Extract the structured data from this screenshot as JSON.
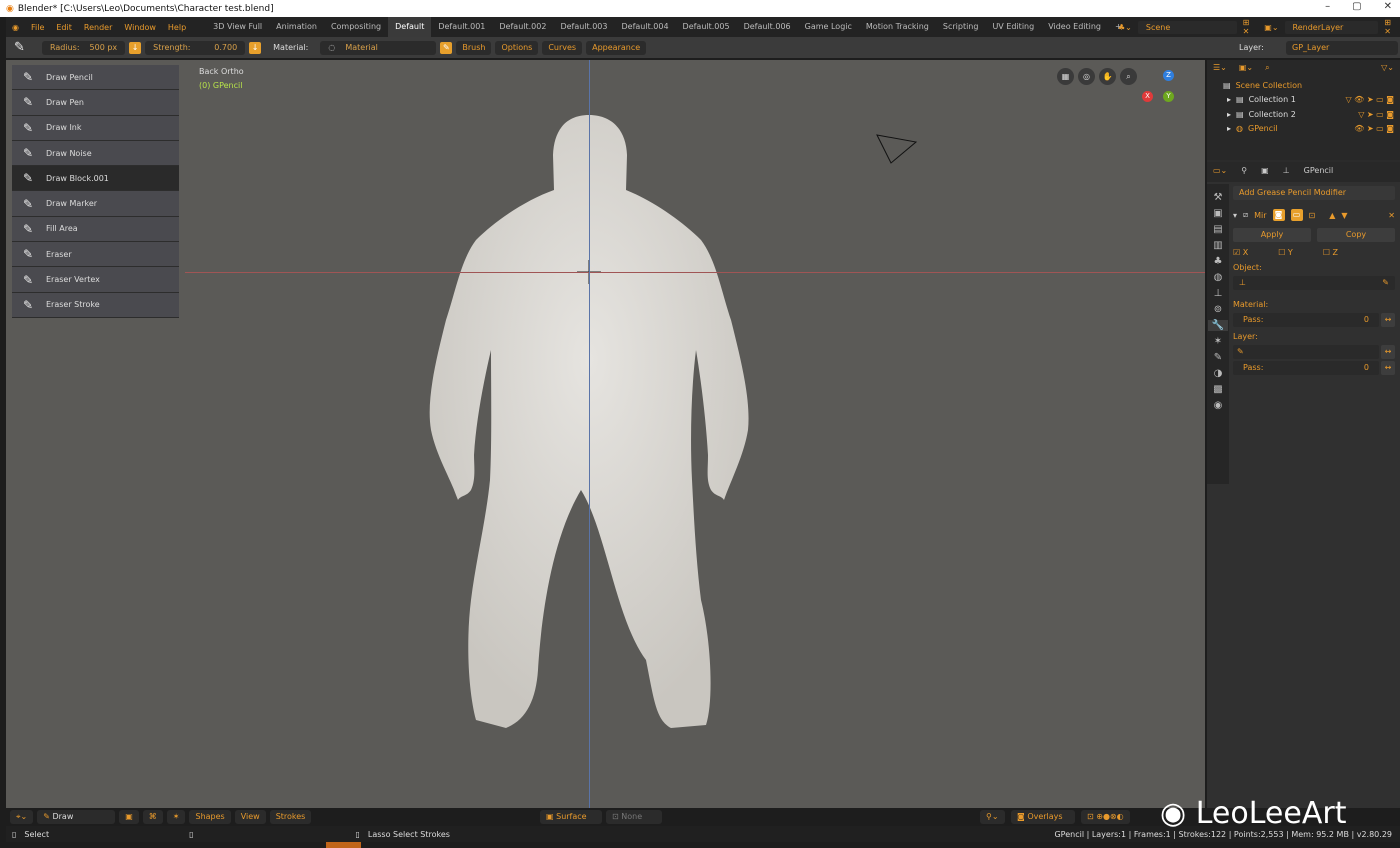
{
  "window": {
    "title": "Blender* [C:\\Users\\Leo\\Documents\\Character test.blend]",
    "minimize": "–",
    "maximize": "▢",
    "close": "✕"
  },
  "menu": [
    "File",
    "Edit",
    "Render",
    "Window",
    "Help"
  ],
  "workspaces": [
    "3D View Full",
    "Animation",
    "Compositing",
    "Default",
    "Default.001",
    "Default.002",
    "Default.003",
    "Default.004",
    "Default.005",
    "Default.006",
    "Game Logic",
    "Motion Tracking",
    "Scripting",
    "UV Editing",
    "Video Editing",
    "+"
  ],
  "active_workspace": "Default",
  "scene": "Scene",
  "view_layer": "RenderLayer",
  "toolheader": {
    "radius_label": "Radius:",
    "radius": "500 px",
    "strength_label": "Strength:",
    "strength": "0.700",
    "material_label": "Material:",
    "material": "Material",
    "brush": "Brush",
    "options": "Options",
    "curves": "Curves",
    "appearance": "Appearance",
    "layer_label": "Layer:",
    "layer": "GP_Layer"
  },
  "tools": [
    {
      "label": "Draw Pencil"
    },
    {
      "label": "Draw Pen"
    },
    {
      "label": "Draw Ink"
    },
    {
      "label": "Draw Noise"
    },
    {
      "label": "Draw Block.001",
      "active": true
    },
    {
      "label": "Draw Marker"
    },
    {
      "label": "Fill Area"
    },
    {
      "label": "Eraser"
    },
    {
      "label": "Eraser Vertex"
    },
    {
      "label": "Eraser Stroke"
    }
  ],
  "viewport": {
    "view": "Back Ortho",
    "object": "(0) GPencil",
    "gizmo": {
      "z": "Z",
      "y": "Y",
      "x": "X"
    }
  },
  "outliner": {
    "root": "Scene Collection",
    "items": [
      "Collection 1",
      "Collection 2",
      "GPencil"
    ]
  },
  "properties": {
    "object": "GPencil",
    "add_modifier": "Add Grease Pencil Modifier",
    "modifier_name": "Mir",
    "apply": "Apply",
    "copy": "Copy",
    "x": "X",
    "y": "Y",
    "z": "Z",
    "x_checked": true,
    "object_label": "Object:",
    "material_label": "Material:",
    "pass_label": "Pass:",
    "material_pass": "0",
    "layer_label": "Layer:",
    "layer_pass": "0"
  },
  "viewport_header": {
    "mode": "Draw",
    "shapes": "Shapes",
    "view": "View",
    "strokes": "Strokes",
    "surface": "Surface",
    "none": "None",
    "overlays": "Overlays"
  },
  "statusbar": {
    "select": "Select",
    "lasso": "Lasso Select Strokes",
    "stats": "GPencil | Layers:1 | Frames:1 | Strokes:122 | Points:2,553 | Mem: 95.2 MB | v2.80.29"
  },
  "watermark": "LeoLeeArt",
  "colors": {
    "accent": "#e89a2c",
    "viewport_bg": "#5b5a57",
    "object_label": "#b7e34a"
  }
}
